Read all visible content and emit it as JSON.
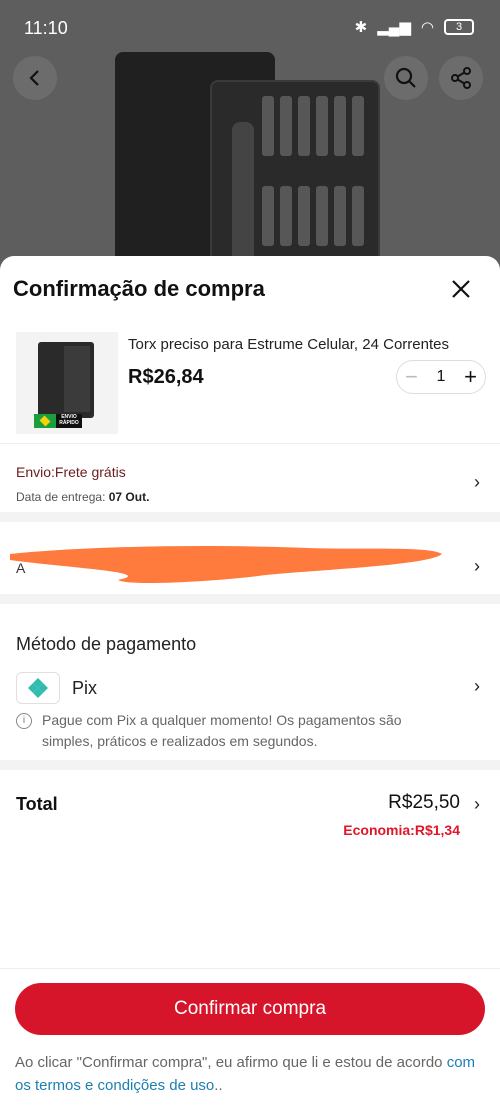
{
  "status_bar": {
    "time": "11:10",
    "battery": "3"
  },
  "icons": {
    "back": "arrow-left-icon",
    "search": "search-icon",
    "share": "share-icon",
    "close": "close-icon"
  },
  "sheet": {
    "title": "Confirmação de compra"
  },
  "product": {
    "name": "Torx preciso para Estrume Celular, 24 Correntes",
    "price": "R$26,84",
    "quantity": "1",
    "badge_text": "ENVIO RÁPIDO"
  },
  "shipping": {
    "label": "Envio:Frete grátis",
    "delivery_label": "Data de entrega:",
    "delivery_date": "07 Out."
  },
  "address": {
    "text_visible": "A"
  },
  "payment": {
    "title": "Método de pagamento",
    "method": "Pix",
    "info": "Pague com Pix a qualquer momento! Os pagamentos são simples, práticos e realizados em segundos."
  },
  "total": {
    "label": "Total",
    "value": "R$25,50",
    "saving": "Economia:R$1,34"
  },
  "footer": {
    "confirm_label": "Confirmar compra",
    "terms_prefix": "Ao clicar \"Confirmar compra\", eu afirmo que li e estou de acordo ",
    "terms_link": "com os termos e condições de uso",
    "terms_suffix": ".."
  },
  "colors": {
    "accent": "#d7152a",
    "saving": "#e0162b",
    "link": "#1b7fb3",
    "pix": "#32bcad",
    "redaction": "#ff7a3d"
  }
}
